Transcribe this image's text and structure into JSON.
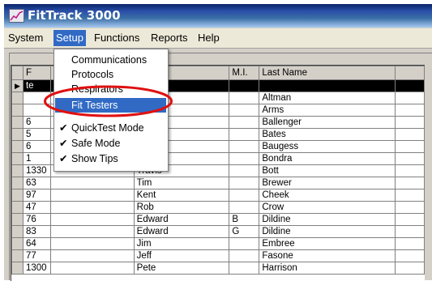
{
  "window": {
    "title": "FitTrack 3000",
    "accent": "#316ac5",
    "highlight_circle": "#e01010"
  },
  "menubar": {
    "items": [
      "System",
      "Setup",
      "Functions",
      "Reports",
      "Help"
    ],
    "active": "Setup"
  },
  "setup_menu": {
    "items": [
      {
        "label": "Communications",
        "checked": false
      },
      {
        "label": "Protocols",
        "checked": false
      },
      {
        "label": "Respirators",
        "checked": false
      },
      {
        "label": "Fit Testers",
        "checked": false,
        "highlighted": true
      },
      {
        "label": "QuickTest Mode",
        "checked": true
      },
      {
        "label": "Safe Mode",
        "checked": true
      },
      {
        "label": "Show Tips",
        "checked": true
      }
    ]
  },
  "grid": {
    "columns": [
      "F",
      "",
      "ame",
      "M.I.",
      "Last Name",
      ""
    ],
    "rows": [
      {
        "id": "te",
        "first": "",
        "mi": "",
        "last": "",
        "selected": true
      },
      {
        "id": "",
        "first": "",
        "mi": "",
        "last": "Altman"
      },
      {
        "id": "",
        "first": "",
        "mi": "",
        "last": "Arms"
      },
      {
        "id": "6",
        "first": "",
        "mi": "",
        "last": "Ballenger"
      },
      {
        "id": "5",
        "first": "",
        "mi": "",
        "last": "Bates"
      },
      {
        "id": "6",
        "first": "",
        "mi": "",
        "last": "Baugess"
      },
      {
        "id": "1",
        "first": "",
        "mi": "",
        "last": "Bondra"
      },
      {
        "id": "1330",
        "first": "Travis",
        "mi": "",
        "last": "Bott"
      },
      {
        "id": "63",
        "first": "Tim",
        "mi": "",
        "last": "Brewer"
      },
      {
        "id": "97",
        "first": "Kent",
        "mi": "",
        "last": "Cheek"
      },
      {
        "id": "47",
        "first": "Rob",
        "mi": "",
        "last": "Crow"
      },
      {
        "id": "76",
        "first": "Edward",
        "mi": "B",
        "last": "Dildine"
      },
      {
        "id": "83",
        "first": "Edward",
        "mi": "G",
        "last": "Dildine"
      },
      {
        "id": "64",
        "first": "Jim",
        "mi": "",
        "last": "Embree"
      },
      {
        "id": "77",
        "first": "Jeff",
        "mi": "",
        "last": "Fasone"
      },
      {
        "id": "1300",
        "first": "Pete",
        "mi": "",
        "last": "Harrison"
      }
    ]
  }
}
